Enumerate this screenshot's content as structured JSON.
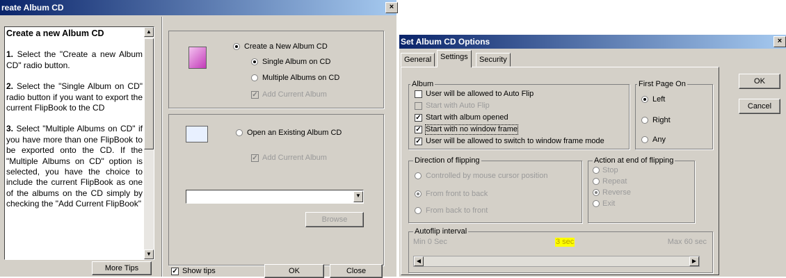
{
  "left_window": {
    "title": "reate Album CD",
    "close_glyph": "×",
    "tips": {
      "heading": "Create a new Album CD",
      "steps": [
        {
          "num": "1.",
          "text": " Select the \"Create a new Album CD\" radio button."
        },
        {
          "num": "2.",
          "text": " Select the \"Single Album on CD\" radio button if you want to export the current FlipBook to the CD"
        },
        {
          "num": "3.",
          "text": " Select \"Multiple Albums on CD\" if you have more than one FlipBook to be exported onto the CD. If the \"Multiple Albums on CD\" option is selected, you have the choice to include the current FlipBook as one of the albums on the CD simply by checking the \"Add Current FlipBook\""
        }
      ]
    },
    "more_tips_label": "More Tips",
    "create_new_label": "Create a New Album CD",
    "single_album_label": "Single Album on CD",
    "multiple_albums_label": "Multiple Albums on CD",
    "add_current_album_label_1": "Add Current Album",
    "open_existing_label": "Open an Existing Album CD",
    "add_current_album_label_2": "Add Current Album",
    "path_value": "",
    "browse_label": "Browse",
    "show_tips_label": "Show tips",
    "ok_label": "OK",
    "close_label": "Close"
  },
  "right_window": {
    "title": "Set Album CD Options",
    "close_glyph": "×",
    "tabs": [
      "General",
      "Settings",
      "Security"
    ],
    "active_tab": "Settings",
    "album_group": {
      "title": "Album",
      "options": [
        {
          "label": "User will be allowed to Auto Flip",
          "checked": false,
          "disabled": false
        },
        {
          "label": "Start with Auto Flip",
          "checked": false,
          "disabled": true
        },
        {
          "label": "Start with album opened",
          "checked": true,
          "disabled": false
        },
        {
          "label": "Start with no window frame",
          "checked": true,
          "disabled": false
        },
        {
          "label": "User will be allowed to switch to window frame mode",
          "checked": true,
          "disabled": false
        }
      ]
    },
    "first_page_group": {
      "title": "First Page On",
      "options": [
        {
          "label": "Left",
          "selected": true
        },
        {
          "label": "Right",
          "selected": false
        },
        {
          "label": "Any",
          "selected": false
        }
      ]
    },
    "direction_group": {
      "title": "Direction of flipping",
      "options": [
        {
          "label": "Controlled by mouse cursor position",
          "selected": false
        },
        {
          "label": "From front to back",
          "selected": true
        },
        {
          "label": "From back to front",
          "selected": false
        }
      ]
    },
    "action_group": {
      "title": "Action at end of flipping",
      "options": [
        {
          "label": "Stop",
          "selected": false
        },
        {
          "label": "Repeat",
          "selected": false
        },
        {
          "label": "Reverse",
          "selected": true
        },
        {
          "label": "Exit",
          "selected": false
        }
      ]
    },
    "autoflip": {
      "title": "Autoflip interval",
      "min_label": "Min 0 Sec",
      "value_label": "3 sec",
      "max_label": "Max 60 sec",
      "value_fraction": 0.05
    },
    "ok_label": "OK",
    "cancel_label": "Cancel"
  },
  "colors": {
    "title_gradient_start": "#0a246a",
    "title_gradient_end": "#a6caf0",
    "dialog_face": "#d4d0c8",
    "highlight": "#ffff00"
  }
}
